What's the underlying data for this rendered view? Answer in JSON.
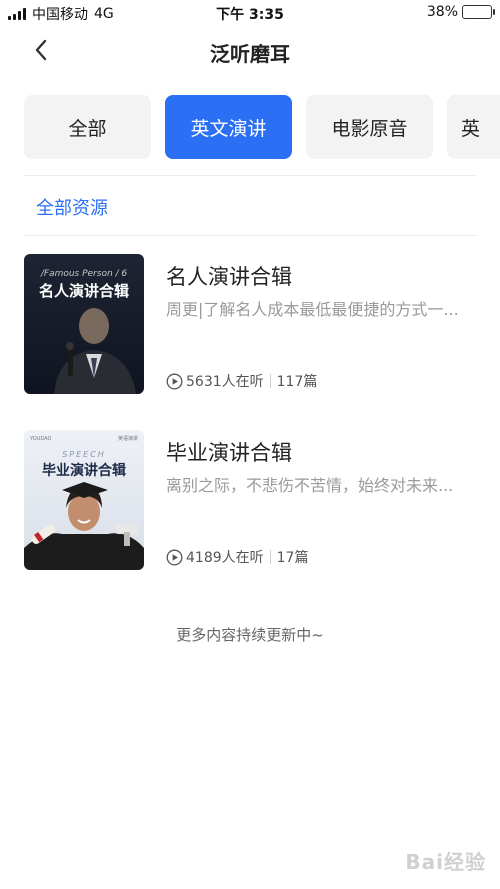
{
  "status_bar": {
    "carrier": "中国移动",
    "network": "4G",
    "time": "下午 3:35",
    "battery": "38%",
    "battery_level": 0.38
  },
  "nav": {
    "title": "泛听磨耳",
    "back_icon": "chevron-left-icon"
  },
  "tabs": [
    {
      "label": "全部",
      "active": false
    },
    {
      "label": "英文演讲",
      "active": true
    },
    {
      "label": "电影原音",
      "active": false
    },
    {
      "label": "英",
      "active": false
    }
  ],
  "section": {
    "label": "全部资源"
  },
  "items": [
    {
      "title": "名人演讲合辑",
      "description": "周更|了解名人成本最低最便捷的方式一...",
      "listeners": "5631人在听",
      "episodes": "117篇",
      "cover": {
        "top_text": "/Famous Person / 6",
        "main_text": "名人演讲合辑"
      }
    },
    {
      "title": "毕业演讲合辑",
      "description": "离别之际，不悲伤不苦情，始终对未来...",
      "listeners": "4189人在听",
      "episodes": "17篇",
      "cover": {
        "brand_left": "YOUDAO",
        "brand_right": "英语演讲",
        "top_text": "SPEECH",
        "main_text": "毕业演讲合辑"
      }
    }
  ],
  "footer_note": "更多内容持续更新中~",
  "watermark": "Bai经验",
  "colors": {
    "accent": "#2b6ff5",
    "tab_bg": "#f3f3f3",
    "muted_text": "#9a9a9a"
  }
}
